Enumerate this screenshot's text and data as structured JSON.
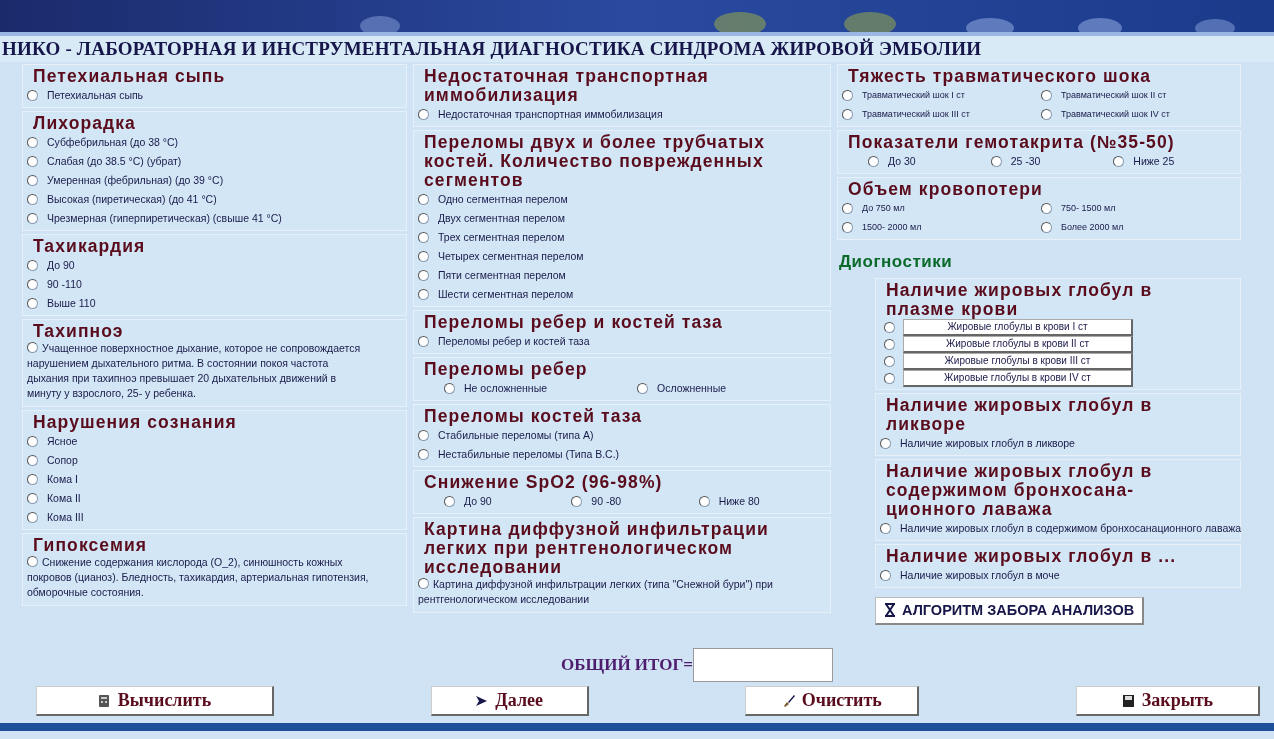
{
  "title": "НИКО - ЛАБОРАТОРНАЯ И ИНСТРУМЕНТАЛЬНАЯ ДИАГНОСТИКА СИНДРОМА ЖИРОВОЙ ЭМБОЛИИ",
  "left_column": [
    {
      "title": "Петехиальная сыпь",
      "kind": "list",
      "options": [
        {
          "label": "Петехиальная сыпь",
          "selected": false
        }
      ]
    },
    {
      "title": "Лихорадка",
      "kind": "list",
      "options": [
        {
          "label": "Субфебрильная (до 38 °C)",
          "selected": false
        },
        {
          "label": "Слабая (до 38.5 °C) (убрат)",
          "selected": false
        },
        {
          "label": "Умеренная (фебрильная) (до 39 °C)",
          "selected": false
        },
        {
          "label": "Высокая (пиретическая) (до 41 °C)",
          "selected": false
        },
        {
          "label": "Чрезмерная (гиперпиретическая) (свыше 41 °C)",
          "selected": false
        }
      ]
    },
    {
      "title": "Тахикардия",
      "kind": "list",
      "options": [
        {
          "label": "До 90",
          "selected": false
        },
        {
          "label": "90 -110",
          "selected": false
        },
        {
          "label": "Выше 110",
          "selected": false
        }
      ]
    },
    {
      "title": "Тахипноэ",
      "kind": "paragraph",
      "options": [
        {
          "label": "Учащенное поверхностное дыхание, которое не сопровождается нарушением дыхательного ритма. В состоянии покоя частота дыхания при тахипноэ превышает 20 дыхательных движений в минуту у взрослого, 25- у ребенка.",
          "selected": false
        }
      ]
    },
    {
      "title": "Нарушения сознания",
      "kind": "list",
      "options": [
        {
          "label": "Ясное",
          "selected": false
        },
        {
          "label": "Сопор",
          "selected": false
        },
        {
          "label": "Кома I",
          "selected": false
        },
        {
          "label": "Кома II",
          "selected": false
        },
        {
          "label": "Кома III",
          "selected": false
        }
      ]
    },
    {
      "title": "Гипоксемия",
      "kind": "paragraph",
      "options": [
        {
          "label": "Снижение содержания кислорода (O_2), синюшность кожных покровов (цианоз). Бледность, тахикардия, артериальная гипотензия, обморочные состояния.",
          "selected": false
        }
      ]
    }
  ],
  "middle_column": [
    {
      "title": "Недостаточная транспортная иммобилизация",
      "kind": "list",
      "options": [
        {
          "label": "Недостаточная транспортная иммобилизация",
          "selected": false
        }
      ]
    },
    {
      "title": "Переломы двух и более трубчатых костей. Количество поврежденных сегментов",
      "kind": "list",
      "options": [
        {
          "label": "Одно сегментная перелом",
          "selected": false
        },
        {
          "label": "Двух  сегментная перелом",
          "selected": false
        },
        {
          "label": "Трех  сегментная перелом",
          "selected": false
        },
        {
          "label": "Четырех    сегментная перелом",
          "selected": false
        },
        {
          "label": "Пяти  сегментная перелом",
          "selected": false
        },
        {
          "label": "Шести  сегментная перелом",
          "selected": false
        }
      ]
    },
    {
      "title": "Переломы ребер и костей таза",
      "kind": "list",
      "options": [
        {
          "label": "Переломы ребер и костей таза",
          "selected": false
        }
      ]
    },
    {
      "title": "Переломы ребер",
      "kind": "pair",
      "options": [
        {
          "label": "Не осложненные",
          "selected": false
        },
        {
          "label": "Осложненные",
          "selected": false
        }
      ]
    },
    {
      "title": "Переломы костей таза",
      "kind": "list",
      "options": [
        {
          "label": "Стабильные переломы (типа А)",
          "selected": false
        },
        {
          "label": "Нестабильные переломы (Типа В.С.)",
          "selected": false
        }
      ]
    },
    {
      "title": "Снижение SpO2 (96-98%)",
      "kind": "triple",
      "options": [
        {
          "label": "До 90",
          "selected": false
        },
        {
          "label": "90 -80",
          "selected": false
        },
        {
          "label": "Ниже 80",
          "selected": false
        }
      ]
    },
    {
      "title": "Картина диффузной инфильтрации легких при рентгенологическом исследовании",
      "kind": "paragraph",
      "options": [
        {
          "label": "Картина диффузной инфильтрации легких (типа \"Снежной бури\") при рентгенологическом исследовании",
          "selected": false
        }
      ]
    }
  ],
  "right_column": [
    {
      "title": "Тяжесть травматического шока",
      "kind": "pair",
      "options": [
        {
          "label": "Травматический шок I ст",
          "selected": false
        },
        {
          "label": "Травматический шок II ст",
          "selected": false
        },
        {
          "label": "Травматический шок III ст",
          "selected": false
        },
        {
          "label": "Травматический шок IV ст",
          "selected": false
        }
      ]
    },
    {
      "title": "Показатели гемотакрита (№35-50)",
      "kind": "triple",
      "options": [
        {
          "label": "До 30",
          "selected": false
        },
        {
          "label": "25 -30",
          "selected": false
        },
        {
          "label": "Ниже 25",
          "selected": false
        }
      ]
    },
    {
      "title": "Объем кровопотери",
      "kind": "pair",
      "options": [
        {
          "label": "До 750 мл",
          "selected": false
        },
        {
          "label": "750- 1500 мл",
          "selected": false
        },
        {
          "label": "1500- 2000 мл",
          "selected": false
        },
        {
          "label": "Более 2000 мл",
          "selected": false
        }
      ]
    }
  ],
  "diagnostics": {
    "heading": "Диогностики",
    "groups": [
      {
        "title": "Наличие жировых глобул в плазме крови",
        "kind": "buttons",
        "options": [
          {
            "label": "Жировые глобулы в крови I ст",
            "selected": false
          },
          {
            "label": "Жировые глобулы в крови II ст",
            "selected": false
          },
          {
            "label": "Жировые глобулы в крови III ст",
            "selected": false
          },
          {
            "label": "Жировые глобулы в крови IV ст",
            "selected": false
          }
        ]
      },
      {
        "title": "Наличие жировых глобул в ликворе",
        "kind": "list",
        "options": [
          {
            "label": "Наличие жировых глобул в ликворе",
            "selected": false
          }
        ]
      },
      {
        "title": "Наличие жировых глобул в содержимом бронхосана-ционного лаважа",
        "kind": "list",
        "options": [
          {
            "label": "Наличие жировых глобул в содержимом бронхосанационного лаважа",
            "selected": false
          }
        ]
      },
      {
        "title": "Наличие жировых глобул в ...",
        "kind": "list",
        "options": [
          {
            "label": "Наличие жировых глобул в моче",
            "selected": false
          }
        ]
      }
    ],
    "algorithm_button": "АЛГОРИТМ ЗАБОРА АНАЛИЗОВ"
  },
  "total": {
    "label": "ОБЩИЙ ИТОГ="
  },
  "buttons": [
    {
      "label": "Вычислить"
    },
    {
      "label": "Далее"
    },
    {
      "label": "Очистить"
    },
    {
      "label": "Закрыть"
    }
  ]
}
